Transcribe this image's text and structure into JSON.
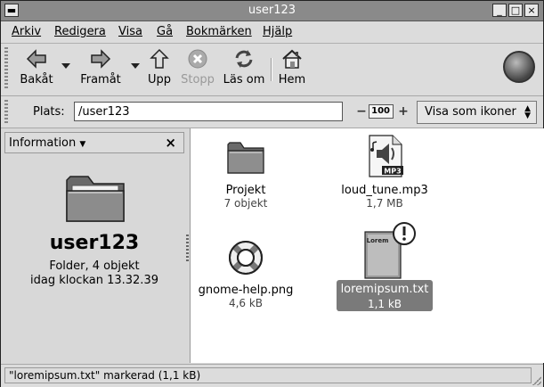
{
  "window": {
    "title": "user123"
  },
  "titlebar_buttons": {
    "menu_icon": "window-menu-icon",
    "minimize": "_",
    "maximize": "□",
    "close": "×"
  },
  "menubar": [
    "Arkiv",
    "Redigera",
    "Visa",
    "Gå",
    "Bokmärken",
    "Hjälp"
  ],
  "toolbar": {
    "back": "Bakåt",
    "forward": "Framåt",
    "up": "Upp",
    "stop": "Stopp",
    "reload": "Läs om",
    "home": "Hem"
  },
  "location": {
    "label": "Plats:",
    "value": "/user123",
    "zoom_minus": "−",
    "zoom": "100",
    "zoom_plus": "+",
    "view_as": "Visa som ikoner"
  },
  "side_pane": {
    "title": "Information",
    "close": "×",
    "name": "user123",
    "type_line": "Folder, 4 objekt",
    "date_line": "idag klockan 13.32.39"
  },
  "files": [
    {
      "name": "Projekt",
      "size": "7 objekt",
      "icon": "folder-icon",
      "selected": false
    },
    {
      "name": "loud_tune.mp3",
      "size": "1,7 MB",
      "icon": "mp3-file-icon",
      "badge": "MP3",
      "selected": false
    },
    {
      "name": "gnome-help.png",
      "size": "4,6 kB",
      "icon": "lifebuoy-icon",
      "selected": false
    },
    {
      "name": "loremipsum.txt",
      "size": "1,1 kB",
      "icon": "text-file-icon",
      "badge": "Lorem",
      "selected": true
    }
  ],
  "status": {
    "text": "\"loremipsum.txt\" markerad (1,1 kB)"
  }
}
